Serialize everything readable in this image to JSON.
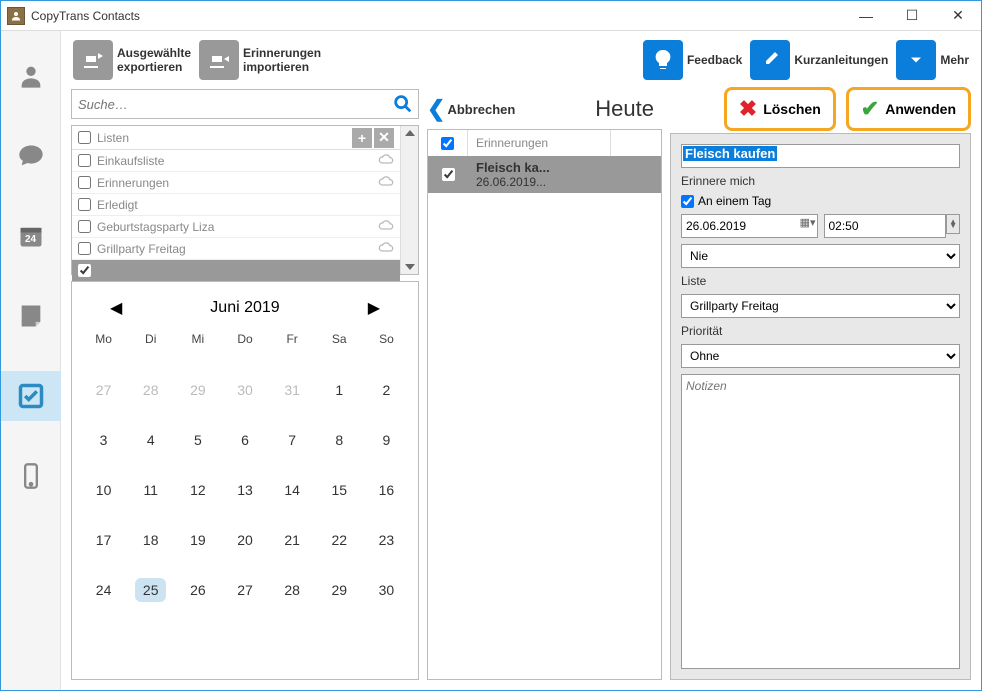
{
  "window": {
    "title": "CopyTrans Contacts"
  },
  "toolbar": {
    "export_l1": "Ausgewählte",
    "export_l2": "exportieren",
    "import_l1": "Erinnerungen",
    "import_l2": "importieren",
    "feedback": "Feedback",
    "guides": "Kurzanleitungen",
    "more": "Mehr"
  },
  "search": {
    "placeholder": "Suche…"
  },
  "lists": {
    "header": "Listen",
    "items": [
      {
        "label": "Einkaufsliste",
        "cloud": true
      },
      {
        "label": "Erinnerungen",
        "cloud": true
      },
      {
        "label": "Erledigt",
        "cloud": false
      },
      {
        "label": "Geburtstagsparty Liza",
        "cloud": true
      },
      {
        "label": "Grillparty Freitag",
        "cloud": true
      }
    ]
  },
  "calendar": {
    "title": "Juni 2019",
    "dow": [
      "Mo",
      "Di",
      "Mi",
      "Do",
      "Fr",
      "Sa",
      "So"
    ],
    "days": [
      {
        "n": "27",
        "g": true
      },
      {
        "n": "28",
        "g": true
      },
      {
        "n": "29",
        "g": true
      },
      {
        "n": "30",
        "g": true
      },
      {
        "n": "31",
        "g": true
      },
      {
        "n": "1"
      },
      {
        "n": "2"
      },
      {
        "n": "3"
      },
      {
        "n": "4"
      },
      {
        "n": "5"
      },
      {
        "n": "6"
      },
      {
        "n": "7"
      },
      {
        "n": "8"
      },
      {
        "n": "9"
      },
      {
        "n": "10"
      },
      {
        "n": "11"
      },
      {
        "n": "12"
      },
      {
        "n": "13"
      },
      {
        "n": "14"
      },
      {
        "n": "15"
      },
      {
        "n": "16"
      },
      {
        "n": "17"
      },
      {
        "n": "18"
      },
      {
        "n": "19"
      },
      {
        "n": "20"
      },
      {
        "n": "21"
      },
      {
        "n": "22"
      },
      {
        "n": "23"
      },
      {
        "n": "24"
      },
      {
        "n": "25",
        "t": true
      },
      {
        "n": "26"
      },
      {
        "n": "27"
      },
      {
        "n": "28"
      },
      {
        "n": "29"
      },
      {
        "n": "30"
      }
    ]
  },
  "mid": {
    "cancel": "Abbrechen",
    "today": "Heute",
    "col_header": "Erinnerungen",
    "row": {
      "title": "Fleisch ka...",
      "date": "26.06.2019..."
    }
  },
  "actions": {
    "delete": "Löschen",
    "apply": "Anwenden"
  },
  "form": {
    "title_value": "Fleisch kaufen",
    "remind_label": "Erinnere mich",
    "on_a_day": "An einem Tag",
    "date": "26.06.2019",
    "time": "02:50",
    "repeat": "Nie",
    "list_label": "Liste",
    "list_value": "Grillparty Freitag",
    "priority_label": "Priorität",
    "priority_value": "Ohne",
    "notes_placeholder": "Notizen"
  },
  "sidenav": {
    "date_badge": "24"
  }
}
